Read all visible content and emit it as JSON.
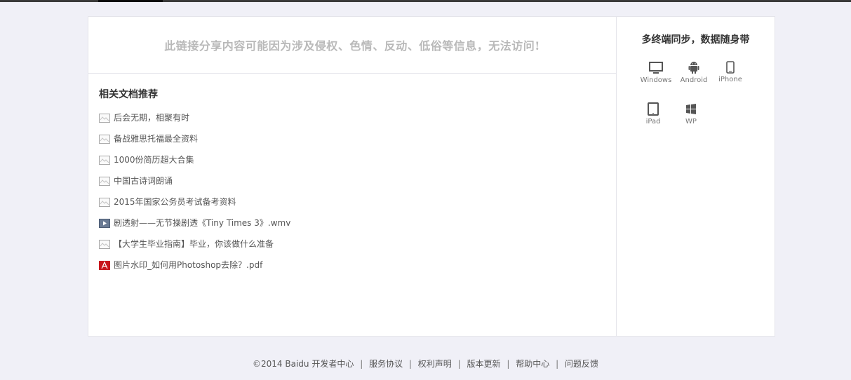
{
  "notice": {
    "text": "此链接分享内容可能因为涉及侵权、色情、反动、低俗等信息，无法访问!"
  },
  "recommend": {
    "title": "相关文档推荐",
    "items": [
      {
        "label": "后会无期，相聚有时",
        "icon": "document-icon"
      },
      {
        "label": "备战雅思托福最全资料",
        "icon": "document-icon"
      },
      {
        "label": "1000份简历超大合集",
        "icon": "document-icon"
      },
      {
        "label": "中国古诗词朗诵",
        "icon": "document-icon"
      },
      {
        "label": "2015年国家公务员考试备考资料",
        "icon": "document-icon"
      },
      {
        "label": "剧透射——无节操剧透《Tiny Times 3》.wmv",
        "icon": "video-file-icon"
      },
      {
        "label": "【大学生毕业指南】毕业，你该做什么准备",
        "icon": "document-icon"
      },
      {
        "label": "图片水印_如何用Photoshop去除？.pdf",
        "icon": "pdf-file-icon"
      }
    ]
  },
  "sidebar": {
    "title": "多终端同步，数据随身带",
    "devices": [
      {
        "label": "Windows",
        "icon": "windows-monitor-icon"
      },
      {
        "label": "Android",
        "icon": "android-icon"
      },
      {
        "label": "iPhone",
        "icon": "iphone-icon"
      },
      {
        "label": "iPad",
        "icon": "ipad-icon"
      },
      {
        "label": "WP",
        "icon": "windows-phone-icon"
      }
    ]
  },
  "footer": {
    "copyright": "©2014 Baidu",
    "links": [
      "开发者中心",
      "服务协议",
      "权利声明",
      "版本更新",
      "帮助中心",
      "问题反馈"
    ]
  },
  "colors": {
    "background": "#f0f0f7",
    "notice_text": "#b9b9b9",
    "pdf_red": "#c8161d"
  }
}
